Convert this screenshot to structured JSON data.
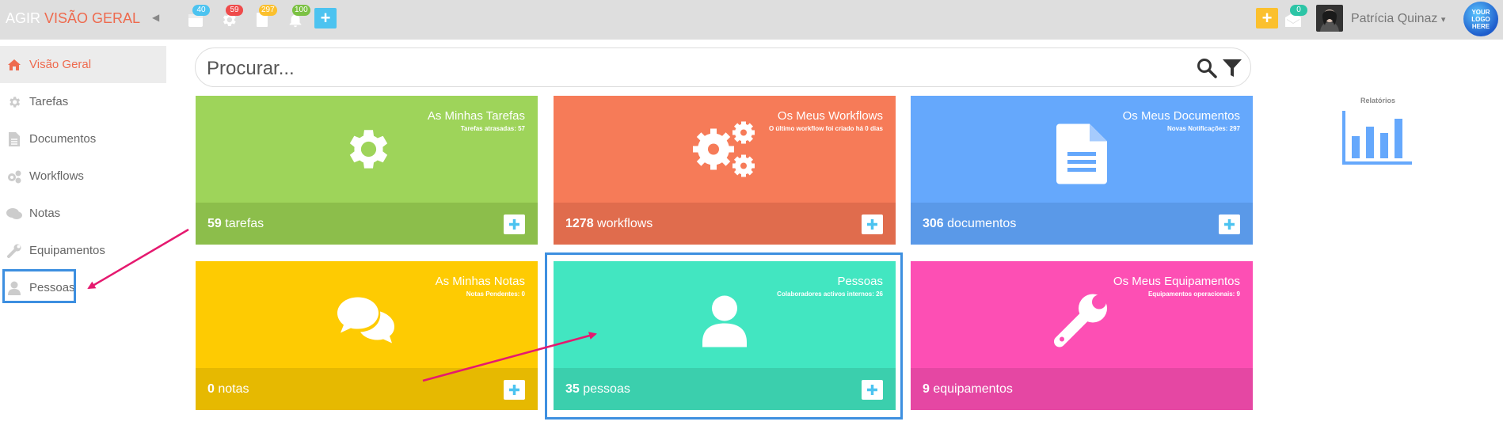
{
  "header": {
    "app_label": "AGIR",
    "page_label": "VISÃO GERAL",
    "calendar_count": "40",
    "settings_count": "59",
    "documents_count": "297",
    "notifications_count": "100",
    "inbox_count": "0",
    "user_name": "Patrícia Quinaz",
    "logo_text": "YOUR LOGO HERE",
    "add_symbol": "+"
  },
  "sidebar": {
    "items": [
      {
        "label": "Visão Geral",
        "icon": "home-icon",
        "active": true
      },
      {
        "label": "Tarefas",
        "icon": "gear-icon"
      },
      {
        "label": "Documentos",
        "icon": "document-icon"
      },
      {
        "label": "Workflows",
        "icon": "gears-icon"
      },
      {
        "label": "Notas",
        "icon": "comments-icon"
      },
      {
        "label": "Equipamentos",
        "icon": "wrench-icon"
      },
      {
        "label": "Pessoas",
        "icon": "user-icon"
      }
    ]
  },
  "search": {
    "placeholder": "Procurar..."
  },
  "cards": [
    {
      "title": "As Minhas Tarefas",
      "subtitle": "Tarefas atrasadas: 57",
      "count": "59",
      "unit": " tarefas",
      "color": "#9ed45a",
      "color_dark": "#8cbe4b",
      "icon": "gear-icon"
    },
    {
      "title": "Os Meus Workflows",
      "subtitle": "O último workflow foi criado há 0 dias",
      "count": "1278",
      "unit": " workflows",
      "color": "#f67b58",
      "color_dark": "#e06c4d",
      "icon": "gears-icon"
    },
    {
      "title": "Os Meus Documentos",
      "subtitle": "Novas Notificações: 297",
      "count": "306",
      "unit": " documentos",
      "color": "#65a8fc",
      "color_dark": "#5a99e8",
      "icon": "document-icon"
    },
    {
      "title": "As Minhas Notas",
      "subtitle": "Notas Pendentes: 0",
      "count": "0",
      "unit": " notas",
      "color": "#fecb02",
      "color_dark": "#e6b901",
      "icon": "comments-icon"
    },
    {
      "title": "Pessoas",
      "subtitle": "Colaboradores activos internos: 26",
      "count": "35",
      "unit": " pessoas",
      "color": "#42e6c1",
      "color_dark": "#3bcfad",
      "icon": "user-icon"
    },
    {
      "title": "Os Meus Equipamentos",
      "subtitle": "Equipamentos operacionais: 9",
      "count": "9",
      "unit": " equipamentos",
      "color": "#fd4fb4",
      "color_dark": "#e547a3",
      "icon": "wrench-icon"
    }
  ],
  "reports": {
    "label": "Relatórios",
    "icon": "bar-chart-icon"
  },
  "colors": {
    "accent": "#ee6a4e",
    "add_blue": "#4cc3f0",
    "add_yellow": "#fbc02d",
    "highlight": "#3d8fe0",
    "arrow": "#e5196f"
  }
}
